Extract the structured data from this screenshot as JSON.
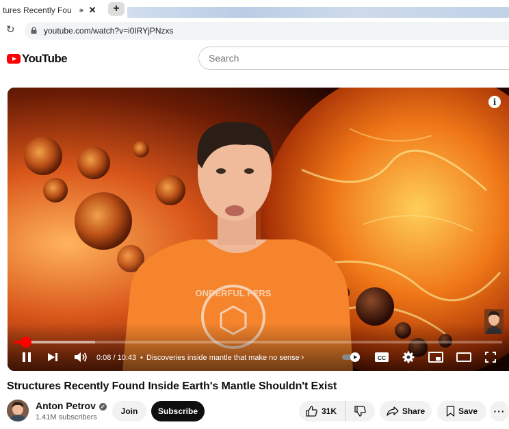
{
  "browser": {
    "tab_title": "tures Recently Fou",
    "url": "youtube.com/watch?v=i0IRYjPNzxs"
  },
  "youtube": {
    "logo_text": "YouTube",
    "search_placeholder": "Search"
  },
  "player": {
    "time": "0:08 / 10:43",
    "chapter": "Discoveries inside mantle that make no sense",
    "progress_played_fraction": 0.024,
    "progress_loaded_fraction": 0.165,
    "shirt_text": "ONDERFUL PERS"
  },
  "video": {
    "title": "Structures Recently Found Inside Earth's Mantle Shouldn't Exist",
    "channel": "Anton Petrov",
    "subscribers": "1.41M subscribers",
    "join_label": "Join",
    "subscribe_label": "Subscribe",
    "likes": "31K",
    "share_label": "Share",
    "save_label": "Save"
  },
  "icons": {
    "reload": "reload-icon",
    "lock": "lock-icon",
    "pause": "pause-icon",
    "next": "next-icon",
    "volume": "volume-icon",
    "autoplay": "autoplay-toggle-icon",
    "cc": "captions-icon",
    "settings": "gear-icon",
    "miniplayer": "miniplayer-icon",
    "theater": "theater-icon",
    "fullscreen": "fullscreen-icon",
    "like": "thumbs-up-icon",
    "dislike": "thumbs-down-icon",
    "share": "share-icon",
    "save": "save-icon",
    "more": "more-icon"
  },
  "colors": {
    "brand_red": "#ff0000",
    "subscribe_bg": "#0f0f0f",
    "pill_bg": "#f2f2f2"
  }
}
